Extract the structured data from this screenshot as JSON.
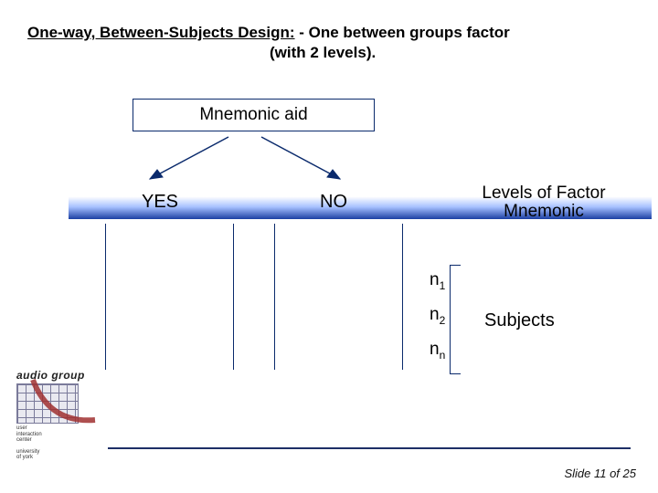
{
  "title": {
    "main_underlined": "One-way, Between-Subjects Design:",
    "main_rest": " - One between groups factor",
    "sub": "(with 2 levels)."
  },
  "factor_box": "Mnemonic aid",
  "levels": {
    "yes": "YES",
    "no": "NO",
    "label_line1": "Levels of Factor",
    "label_line2": "Mnemonic"
  },
  "subjects": {
    "n1": "n",
    "n1_sub": "1",
    "n2": "n",
    "n2_sub": "2",
    "nn": "n",
    "nn_sub": "n",
    "label": "Subjects"
  },
  "footer": {
    "slide_label": "Slide 11 of 25"
  },
  "logo": {
    "title": "audio group",
    "sub_line1": "user",
    "sub_line2": "interaction",
    "sub_line3": "center",
    "footer1": "university",
    "footer2": "of york"
  }
}
